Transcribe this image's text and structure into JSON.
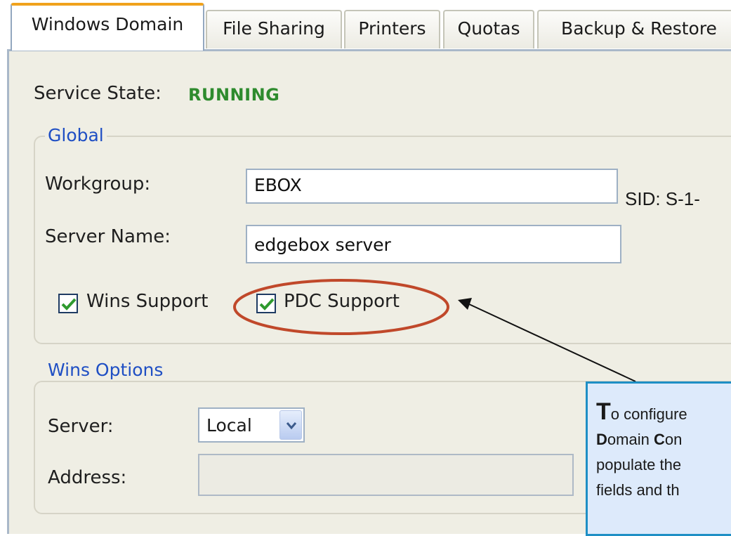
{
  "tabs": [
    {
      "label": "Windows Domain",
      "active": true
    },
    {
      "label": "File Sharing",
      "active": false
    },
    {
      "label": "Printers",
      "active": false
    },
    {
      "label": "Quotas",
      "active": false
    },
    {
      "label": "Backup & Restore",
      "active": false
    }
  ],
  "service": {
    "label": "Service State:",
    "value": "RUNNING"
  },
  "global": {
    "legend": "Global",
    "workgroup_label": "Workgroup:",
    "workgroup_value": "EBOX",
    "sid_text": "SID: S-1-",
    "server_name_label": "Server Name:",
    "server_name_value": "edgebox server",
    "wins_support_label": "Wins Support",
    "wins_support_checked": true,
    "pdc_support_label": "PDC Support",
    "pdc_support_checked": true
  },
  "wins_options": {
    "legend": "Wins Options",
    "server_label": "Server:",
    "server_value": "Local",
    "address_label": "Address:",
    "address_value": ""
  },
  "callout": {
    "line1_initial": "T",
    "line1_rest": "o configure",
    "line2_d": "D",
    "line2_a": "omain ",
    "line2_c": "C",
    "line2_b": "on",
    "line3": "populate the",
    "line4": "fields and th"
  },
  "colors": {
    "highlight_ellipse": "#c0482a",
    "running": "#2e8b2e",
    "legend": "#1f4fc4",
    "callout_border": "#1e8fc5"
  }
}
